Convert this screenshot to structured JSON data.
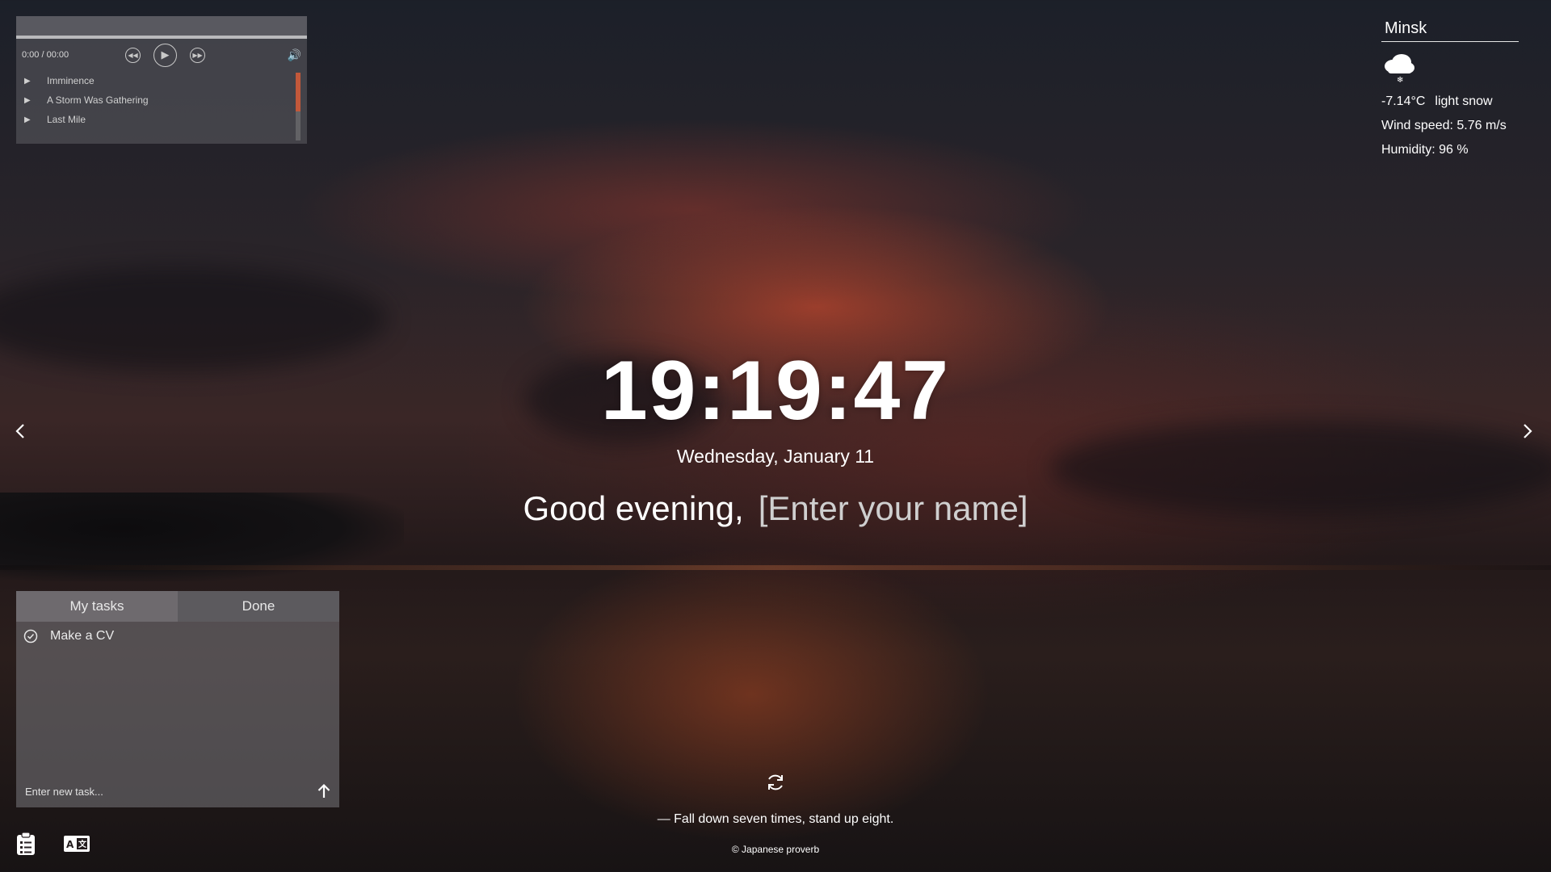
{
  "player": {
    "time": "0:00 / 00:00",
    "prev_icon": "rewind-icon",
    "play_icon": "play-icon",
    "next_icon": "fast-forward-icon",
    "volume_icon": "volume-icon",
    "tracks": [
      "Imminence",
      "A Storm Was Gathering",
      "Last Mile"
    ]
  },
  "weather": {
    "city": "Minsk",
    "icon": "snow-cloud-icon",
    "temperature": "-7.14°C",
    "description": "light snow",
    "wind": "Wind speed: 5.76 m/s",
    "humidity": "Humidity: 96 %"
  },
  "clock": {
    "time": "19:19:47",
    "date": "Wednesday, January 11"
  },
  "greeting": {
    "text": "Good evening,",
    "name_placeholder": "[Enter your name]"
  },
  "todo": {
    "tabs": [
      "My tasks",
      "Done"
    ],
    "tasks": [
      "Make a CV"
    ],
    "input_placeholder": "Enter new task..."
  },
  "quote": {
    "text": "— Fall down seven times, stand up eight.",
    "author": "© Japanese proverb"
  },
  "colors": {
    "accent_scroll": "#c2583a",
    "text": "#ffffff"
  }
}
